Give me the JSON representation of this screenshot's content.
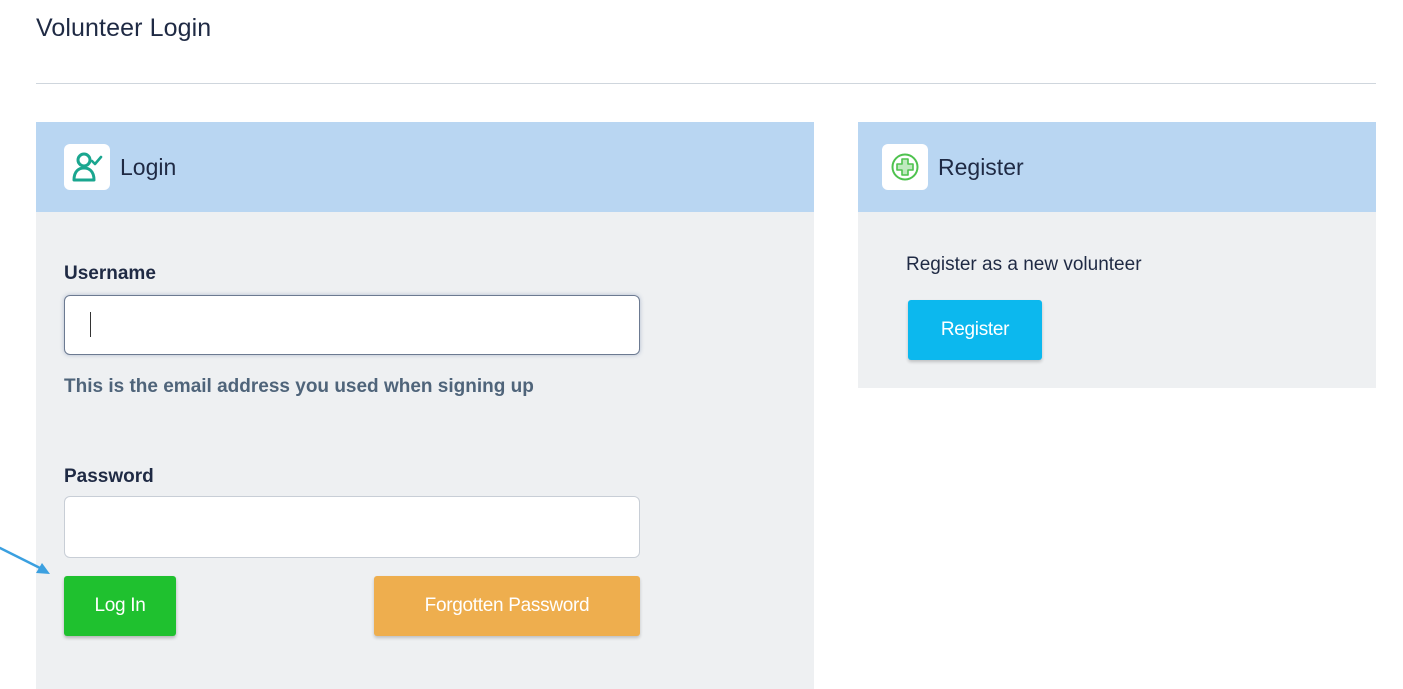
{
  "page": {
    "title": "Volunteer Login"
  },
  "login_panel": {
    "heading": "Login",
    "icon": "user-check-icon",
    "username_label": "Username",
    "username_value": "",
    "username_help": "This is the email address you used when signing up",
    "password_label": "Password",
    "password_value": "",
    "login_button": "Log In",
    "forgot_button": "Forgotten Password"
  },
  "register_panel": {
    "heading": "Register",
    "icon": "plus-circle-icon",
    "description": "Register as a new volunteer",
    "register_button": "Register"
  },
  "colors": {
    "header_bg": "#b9d6f2",
    "panel_bg": "#eef0f2",
    "login_button": "#1fc12f",
    "forgot_button": "#eeae4e",
    "register_button": "#0cb8ee",
    "icon_accent": "#1aa68f",
    "plus_accent": "#4ec24e",
    "arrow": "#3ba0e0"
  }
}
